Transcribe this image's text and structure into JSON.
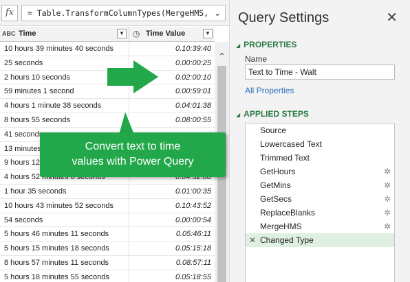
{
  "formula": {
    "fx_label": "fx",
    "text": "= Table.TransformColumnTypes(MergeHMS,",
    "chevron": "⌄"
  },
  "grid": {
    "columns": [
      {
        "icon": "ABC",
        "label": "Time"
      },
      {
        "icon": "◷",
        "label": "Time Value"
      }
    ],
    "rows": [
      {
        "text": "10 hours 39 minutes 40 seconds",
        "value": "0.10:39:40"
      },
      {
        "text": "25 seconds",
        "value": "0.00:00:25"
      },
      {
        "text": "2 hours 10 seconds",
        "value": "0.02:00:10"
      },
      {
        "text": "59 minutes 1 second",
        "value": "0.00:59:01"
      },
      {
        "text": "4 hours 1 minute 38 seconds",
        "value": "0.04:01:38"
      },
      {
        "text": "8 hours 55 seconds",
        "value": "0.08:00:55"
      },
      {
        "text": "41 seconds",
        "value": ""
      },
      {
        "text": "13 minutes",
        "value": ""
      },
      {
        "text": "9 hours 12 minutes",
        "value": ""
      },
      {
        "text": "4 hours 52 minutes 8 seconds",
        "value": "0.04:52:08"
      },
      {
        "text": "1 hour 35 seconds",
        "value": "0.01:00:35"
      },
      {
        "text": "10 hours 43 minutes 52 seconds",
        "value": "0.10:43:52"
      },
      {
        "text": "54 seconds",
        "value": "0.00:00:54"
      },
      {
        "text": "5 hours 46 minutes 11 seconds",
        "value": "0.05:46:11"
      },
      {
        "text": "5 hours 15 minutes 18 seconds",
        "value": "0.05:15:18"
      },
      {
        "text": "8 hours 57 minutes 11 seconds",
        "value": "0.08:57:11"
      },
      {
        "text": "5 hours 18 minutes 55 seconds",
        "value": "0.05:18:55"
      }
    ]
  },
  "callout": {
    "line1": "Convert text to time",
    "line2": "values with Power Query"
  },
  "query_settings": {
    "title": "Query Settings",
    "close": "✕",
    "properties_heading": "PROPERTIES",
    "name_label": "Name",
    "name_value": "Text to Time - Walt",
    "all_properties": "All Properties",
    "steps_heading": "APPLIED STEPS",
    "steps": [
      {
        "label": "Source",
        "gear": ""
      },
      {
        "label": "Lowercased Text",
        "gear": ""
      },
      {
        "label": "Trimmed Text",
        "gear": ""
      },
      {
        "label": "GetHours",
        "gear": "✲"
      },
      {
        "label": "GetMins",
        "gear": "✲"
      },
      {
        "label": "GetSecs",
        "gear": "✲"
      },
      {
        "label": "ReplaceBlanks",
        "gear": "✲"
      },
      {
        "label": "MergeHMS",
        "gear": "✲"
      },
      {
        "label": "Changed Type",
        "gear": "",
        "x": "✕"
      }
    ]
  },
  "colors": {
    "accent_green": "#22a84a",
    "heading_green": "#2a7a43",
    "link_blue": "#2a6eb8",
    "selected_step_bg": "#dff0e2"
  }
}
